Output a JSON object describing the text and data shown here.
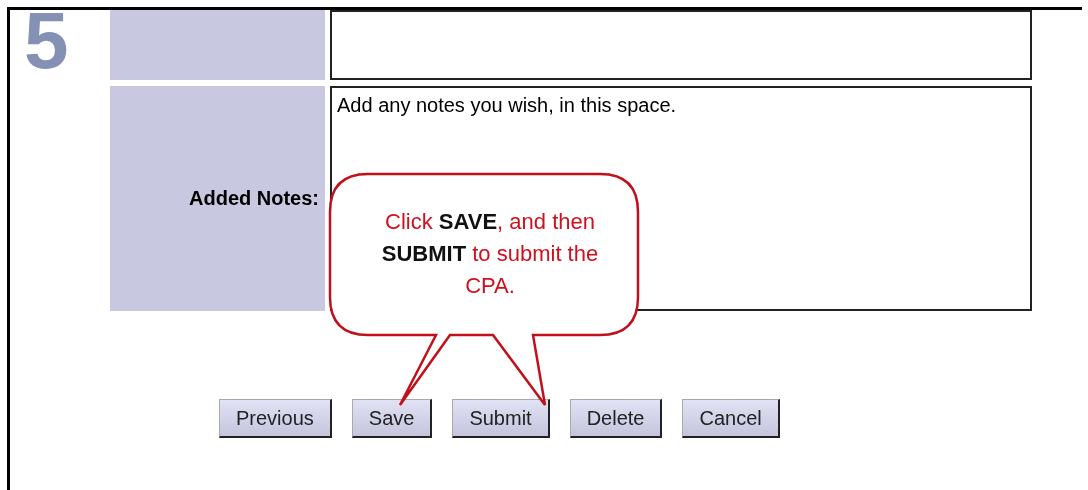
{
  "step_number": "5",
  "form": {
    "rows": [
      {
        "kind": "empty"
      },
      {
        "label": "Added Notes:",
        "kind": "notes",
        "value": "Add any notes you wish, in this space."
      }
    ]
  },
  "callout": {
    "text": "Click **SAVE**, and then **SUBMIT** to submit the CPA."
  },
  "buttons": [
    {
      "label": "Previous"
    },
    {
      "label": "Save"
    },
    {
      "label": "Submit"
    },
    {
      "label": "Delete"
    },
    {
      "label": "Cancel"
    }
  ]
}
